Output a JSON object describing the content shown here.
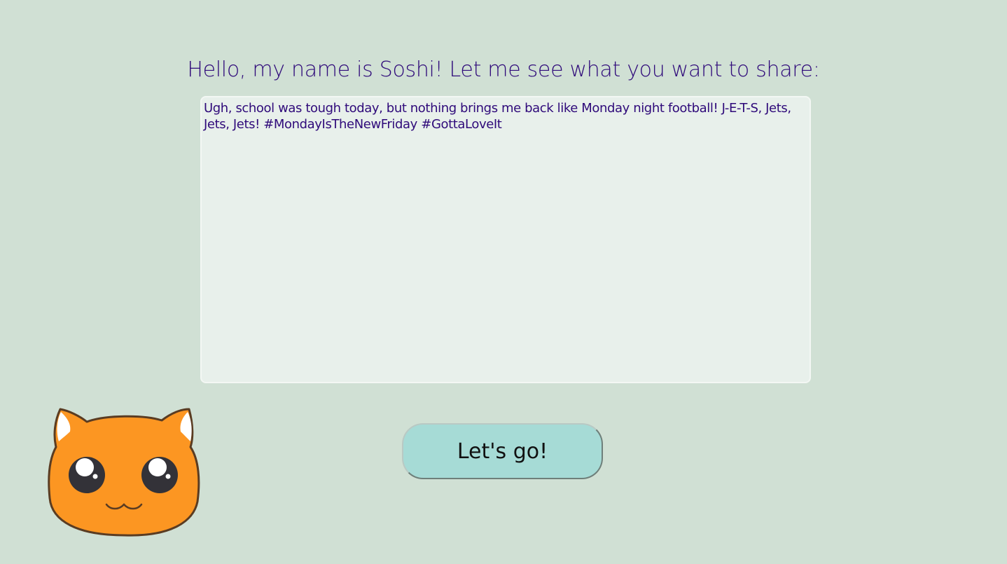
{
  "header": {
    "title": "Hello, my name is Soshi! Let me see what you want to share:"
  },
  "composer": {
    "text": "Ugh, school was tough today, but nothing brings me back like Monday night football! J-E-T-S, Jets, Jets, Jets! #MondayIsTheNewFriday #GottaLoveIt"
  },
  "actions": {
    "submit_label": "Let's go!"
  },
  "mascot": {
    "icon": "orange-cat-face-icon"
  },
  "colors": {
    "background": "#d0e0d4",
    "text": "#2f0a7a",
    "button": "#a6dbd6",
    "mascot": "#fc9622"
  }
}
